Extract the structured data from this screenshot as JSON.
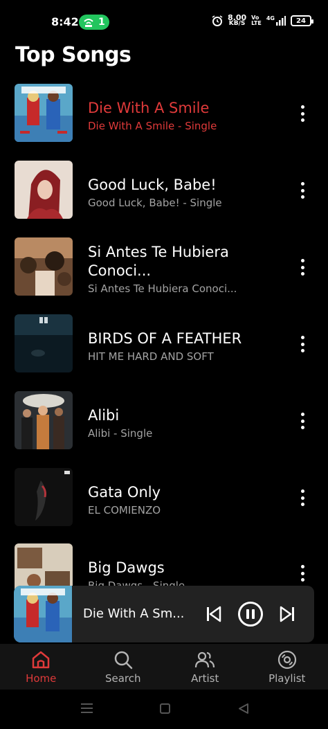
{
  "status_bar": {
    "time": "8:42",
    "hotspot_count": "1",
    "speed_value": "8.00",
    "speed_unit": "KB/S",
    "volte_top": "Vo",
    "volte_bottom": "LTE",
    "network": "4G",
    "battery": "24"
  },
  "page": {
    "title": "Top Songs"
  },
  "songs": [
    {
      "title": "Die With A Smile",
      "subtitle": "Die With A Smile - Single",
      "active": true
    },
    {
      "title": "Good Luck, Babe!",
      "subtitle": "Good Luck, Babe! - Single",
      "active": false
    },
    {
      "title": "Si Antes Te Hubiera Conoci...",
      "subtitle": "Si Antes Te Hubiera Conoci...",
      "active": false
    },
    {
      "title": "BIRDS OF A FEATHER",
      "subtitle": "HIT ME HARD AND SOFT",
      "active": false
    },
    {
      "title": "Alibi",
      "subtitle": "Alibi - Single",
      "active": false
    },
    {
      "title": "Gata Only",
      "subtitle": "EL COMIENZO",
      "active": false
    },
    {
      "title": "Big Dawgs",
      "subtitle": "Big Dawgs - Single",
      "active": false
    }
  ],
  "mini_player": {
    "title": "Die With A Sm..."
  },
  "bottom_nav": {
    "items": [
      {
        "label": "Home",
        "icon": "home-icon",
        "active": true
      },
      {
        "label": "Search",
        "icon": "search-icon",
        "active": false
      },
      {
        "label": "Artist",
        "icon": "artist-icon",
        "active": false
      },
      {
        "label": "Playlist",
        "icon": "playlist-icon",
        "active": false
      }
    ]
  },
  "colors": {
    "accent": "#e03a3a",
    "background": "#000000",
    "player_bg": "#222222",
    "nav_bg": "#141414",
    "hotspot": "#22c55e"
  }
}
